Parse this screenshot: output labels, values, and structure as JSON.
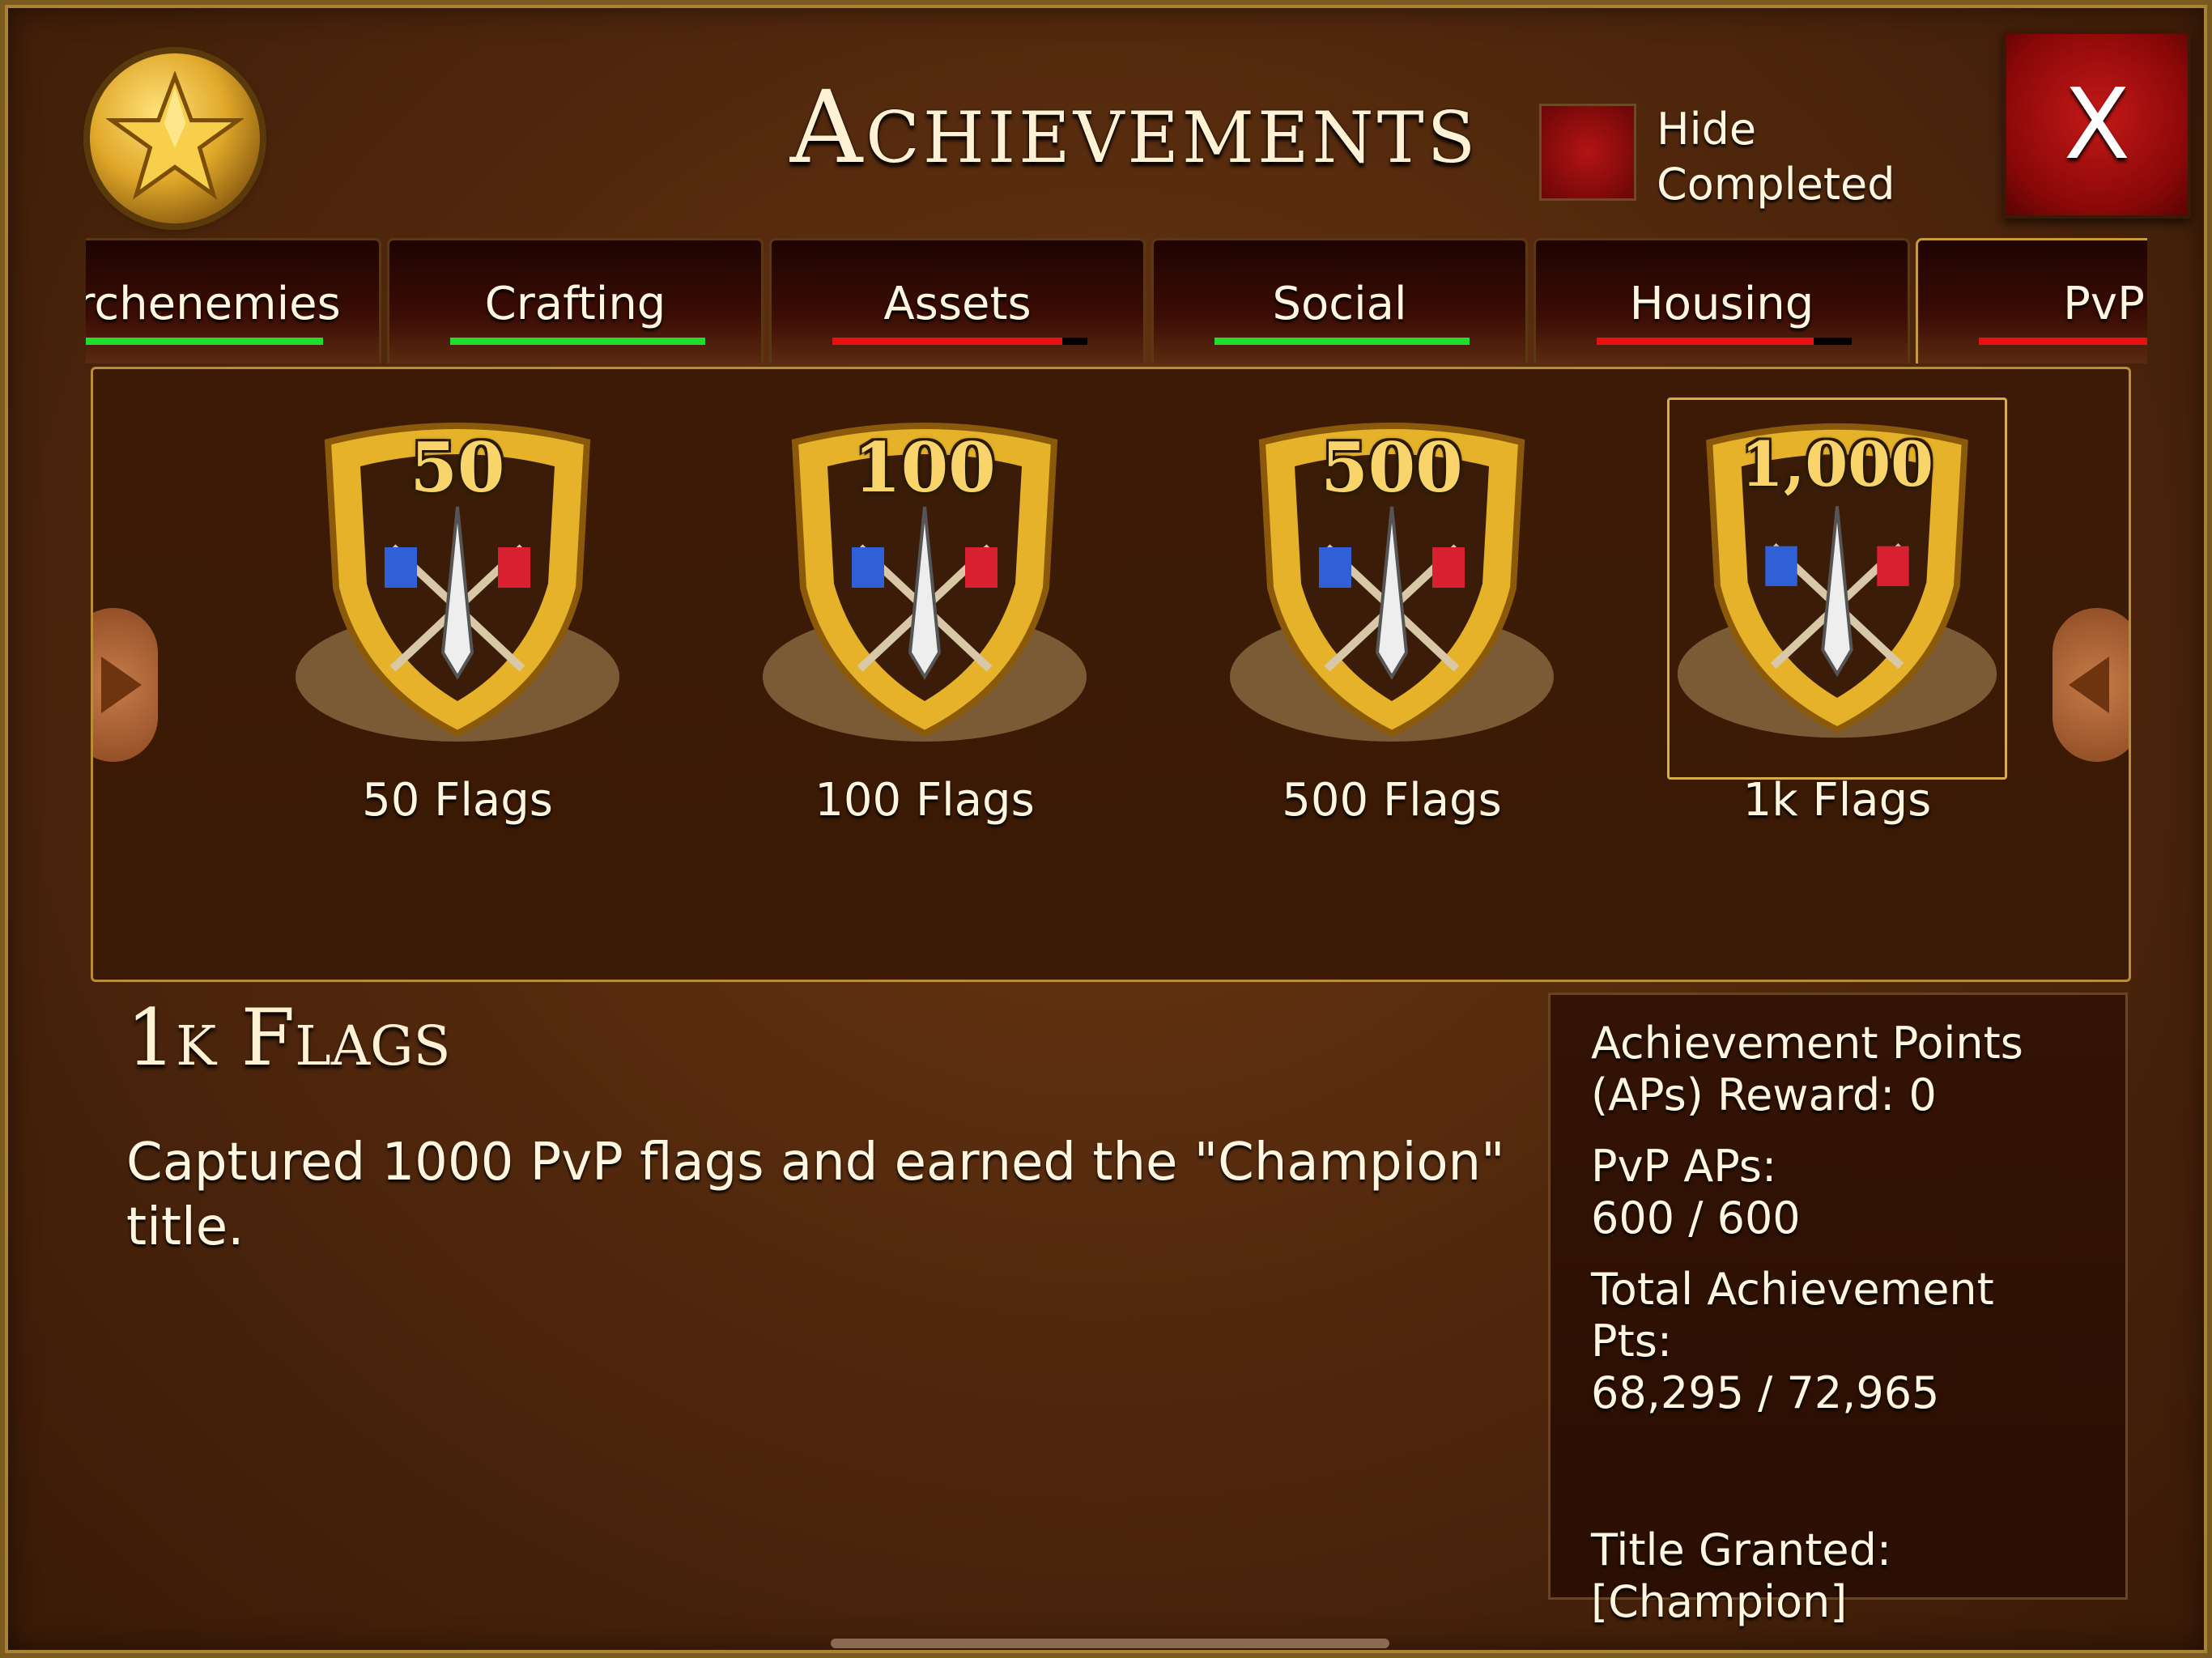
{
  "header": {
    "title": "Achievements",
    "hide_completed_label": "Hide Completed",
    "close_label": "X"
  },
  "tabs": [
    {
      "label": "Archenemies",
      "progress": 1.0,
      "color": "#1ee02c"
    },
    {
      "label": "Crafting",
      "progress": 1.0,
      "color": "#1ee02c"
    },
    {
      "label": "Assets",
      "progress": 0.9,
      "color": "#e81010"
    },
    {
      "label": "Social",
      "progress": 1.0,
      "color": "#1ee02c"
    },
    {
      "label": "Housing",
      "progress": 0.85,
      "color": "#e81010"
    },
    {
      "label": "PvP",
      "progress": 0.85,
      "color": "#e81010"
    }
  ],
  "badges": [
    {
      "number": "50",
      "caption": "50 Flags"
    },
    {
      "number": "100",
      "caption": "100 Flags"
    },
    {
      "number": "500",
      "caption": "500 Flags"
    },
    {
      "number": "1,000",
      "caption": "1k Flags",
      "selected": true
    }
  ],
  "detail": {
    "title": "1k Flags",
    "description": "Captured 1000 PvP flags and earned the \"Champion\" title."
  },
  "stats": {
    "reward": "Achievement Points (APs) Reward: 0",
    "category_label": "PvP APs:",
    "category_value": "600 / 600",
    "total_label": "Total Achievement Pts:",
    "total_value": "68,295 / 72,965",
    "title_label": "Title Granted:",
    "title_value": "[Champion]"
  }
}
